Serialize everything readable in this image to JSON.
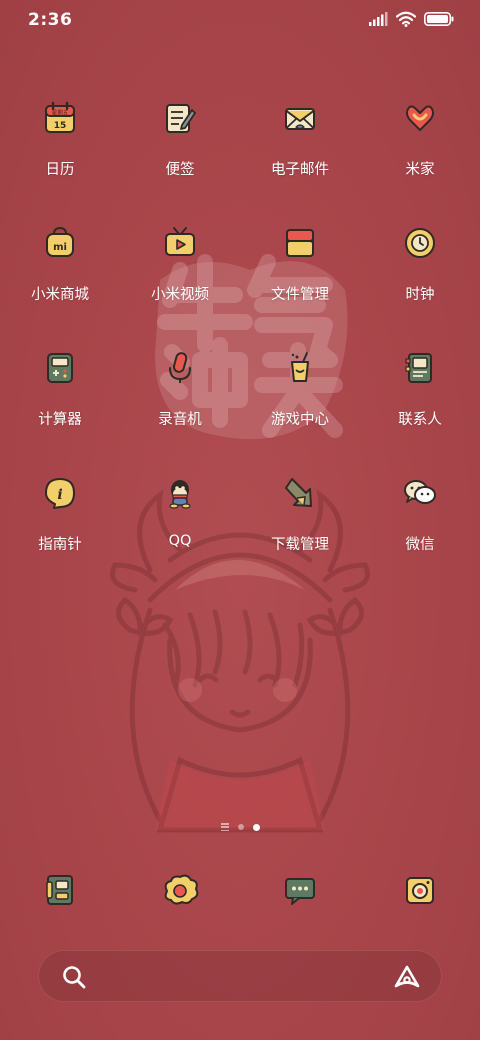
{
  "status_bar": {
    "time": "2:36",
    "icons": [
      "signal-icon",
      "wifi-icon",
      "battery-icon"
    ],
    "battery_level": 1.0
  },
  "wallpaper": {
    "text": "牛气冲天"
  },
  "apps": [
    {
      "label": "日历",
      "icon": "calendar-icon",
      "icon_text_top": "星期五",
      "icon_text_bottom": "15"
    },
    {
      "label": "便签",
      "icon": "notes-icon"
    },
    {
      "label": "电子邮件",
      "icon": "email-icon"
    },
    {
      "label": "米家",
      "icon": "mijia-icon"
    },
    {
      "label": "小米商城",
      "icon": "mi-store-icon",
      "icon_text": "mi"
    },
    {
      "label": "小米视频",
      "icon": "video-icon"
    },
    {
      "label": "文件管理",
      "icon": "file-manager-icon"
    },
    {
      "label": "时钟",
      "icon": "clock-icon"
    },
    {
      "label": "计算器",
      "icon": "calculator-icon"
    },
    {
      "label": "录音机",
      "icon": "recorder-icon"
    },
    {
      "label": "游戏中心",
      "icon": "game-center-icon"
    },
    {
      "label": "联系人",
      "icon": "contacts-icon"
    },
    {
      "label": "指南针",
      "icon": "compass-icon",
      "icon_text": "i"
    },
    {
      "label": "QQ",
      "icon": "qq-icon"
    },
    {
      "label": "下载管理",
      "icon": "download-icon"
    },
    {
      "label": "微信",
      "icon": "wechat-icon"
    }
  ],
  "page_indicator": {
    "pages": 2,
    "current": 2
  },
  "dock": [
    {
      "icon": "phone-icon"
    },
    {
      "icon": "browser-icon"
    },
    {
      "icon": "messages-icon"
    },
    {
      "icon": "camera-icon"
    }
  ],
  "search_bar": {
    "left_icon": "search-icon",
    "right_icon": "assistant-icon"
  },
  "colors": {
    "background": "#a8454a",
    "icon_outline": "#2f2a26",
    "icon_yellow": "#f2cf6a",
    "icon_red": "#e8584f",
    "icon_green": "#5e7a62",
    "icon_cream": "#f3e7c7"
  }
}
